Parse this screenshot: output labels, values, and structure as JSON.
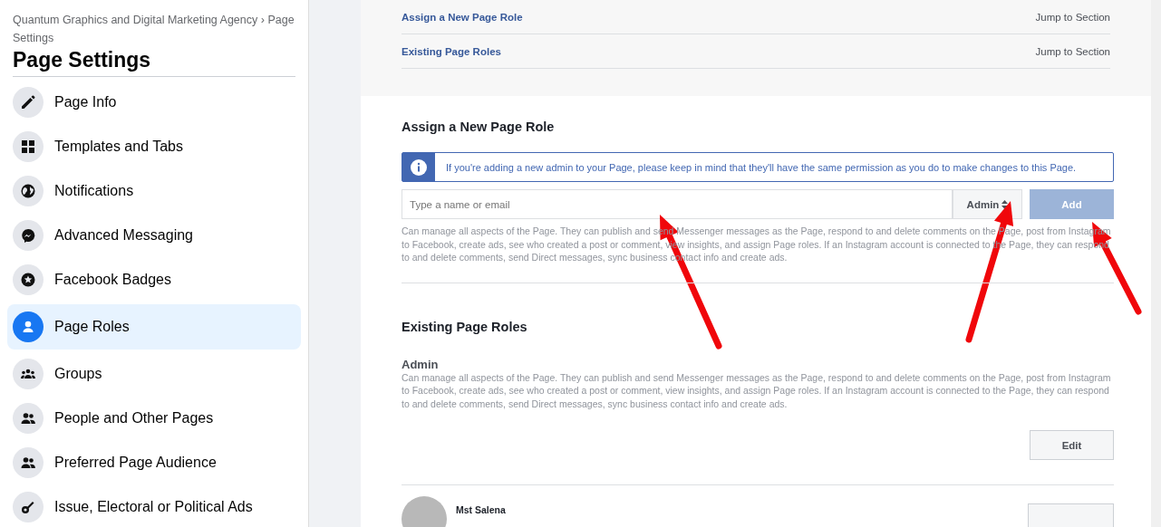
{
  "sidebar": {
    "breadcrumb": "Quantum Graphics and Digital Marketing Agency › Page Settings",
    "title": "Page Settings",
    "items": [
      {
        "label": "Page Info",
        "selected": false
      },
      {
        "label": "Templates and Tabs",
        "selected": false
      },
      {
        "label": "Notifications",
        "selected": false
      },
      {
        "label": "Advanced Messaging",
        "selected": false
      },
      {
        "label": "Facebook Badges",
        "selected": false
      },
      {
        "label": "Page Roles",
        "selected": true
      },
      {
        "label": "Groups",
        "selected": false
      },
      {
        "label": "People and Other Pages",
        "selected": false
      },
      {
        "label": "Preferred Page Audience",
        "selected": false
      },
      {
        "label": "Issue, Electoral or Political Ads",
        "selected": false
      }
    ]
  },
  "jump_links": [
    {
      "label": "Assign a New Page Role",
      "action": "Jump to Section"
    },
    {
      "label": "Existing Page Roles",
      "action": "Jump to Section"
    }
  ],
  "assign": {
    "heading": "Assign a New Page Role",
    "notice": "If you're adding a new admin to your Page, please keep in mind that they'll have the same permission as you do to make changes to this Page.",
    "name_field": {
      "placeholder": "Type a name or email"
    },
    "role_select": "Admin",
    "add_button": "Add",
    "description": "Can manage all aspects of the Page. They can publish and send Messenger messages as the Page, respond to and delete comments on the Page, post from Instagram to Facebook, create ads, see who created a post or comment, view insights, and assign Page roles. If an Instagram account is connected to the Page, they can respond to and delete comments, send Direct messages, sync business contact info and create ads."
  },
  "existing": {
    "heading": "Existing Page Roles",
    "role": "Admin",
    "description": "Can manage all aspects of the Page. They can publish and send Messenger messages as the Page, respond to and delete comments on the Page, post from Instagram to Facebook, create ads, see who created a post or comment, view insights, and assign Page roles. If an Instagram account is connected to the Page, they can respond to and delete comments, send Direct messages, sync business contact info and create ads.",
    "edit_button": "Edit",
    "person": "Mst Salena"
  }
}
